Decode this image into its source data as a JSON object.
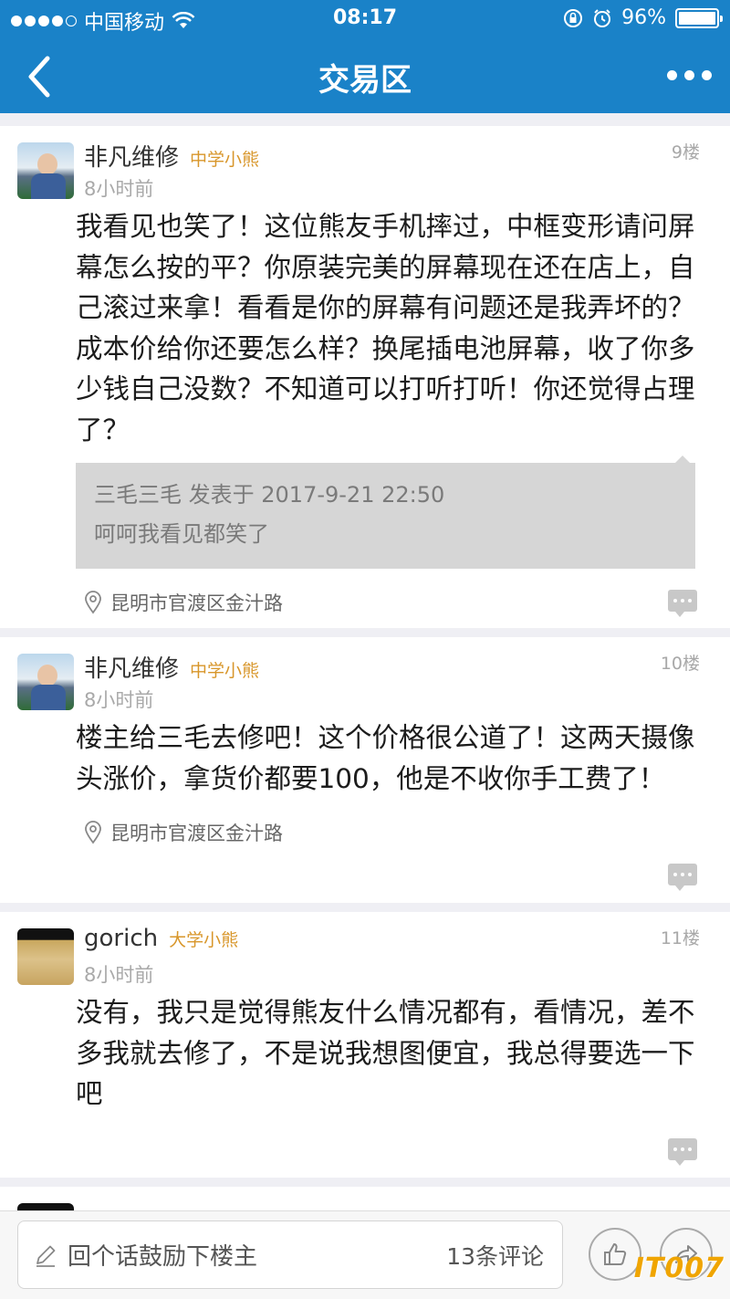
{
  "status_bar": {
    "carrier": "中国移动",
    "time": "08:17",
    "battery": "96%"
  },
  "nav": {
    "title": "交易区"
  },
  "posts": [
    {
      "username": "非凡维修",
      "badge": "中学小熊",
      "floor": "9楼",
      "time": "8小时前",
      "content": "我看见也笑了！这位熊友手机摔过，中框变形请问屏幕怎么按的平？你原装完美的屏幕现在还在店上，自己滚过来拿！看看是你的屏幕有问题还是我弄坏的？成本价给你还要怎么样？换尾插电池屏幕，收了你多少钱自己没数？不知道可以打听打听！你还觉得占理了？",
      "quote_header": "三毛三毛 发表于 2017-9-21 22:50",
      "quote_text": "呵呵我看见都笑了",
      "location": "昆明市官渡区金汁路"
    },
    {
      "username": "非凡维修",
      "badge": "中学小熊",
      "floor": "10楼",
      "time": "8小时前",
      "content": "楼主给三毛去修吧！这个价格很公道了！这两天摄像头涨价，拿货价都要100，他是不收你手工费了！",
      "location": "昆明市官渡区金汁路"
    },
    {
      "username": "gorich",
      "badge": "大学小熊",
      "floor": "11楼",
      "time": "8小时前",
      "content": "没有，我只是觉得熊友什么情况都有，看情况，差不多我就去修了，不是说我想图便宜，我总得要选一下吧"
    }
  ],
  "bottom_bar": {
    "placeholder": "回个话鼓励下楼主",
    "comment_count": "13条评论"
  },
  "watermark": "IT007",
  "colors": {
    "header_bg": "#1a82c8",
    "badge": "#d8962a"
  }
}
